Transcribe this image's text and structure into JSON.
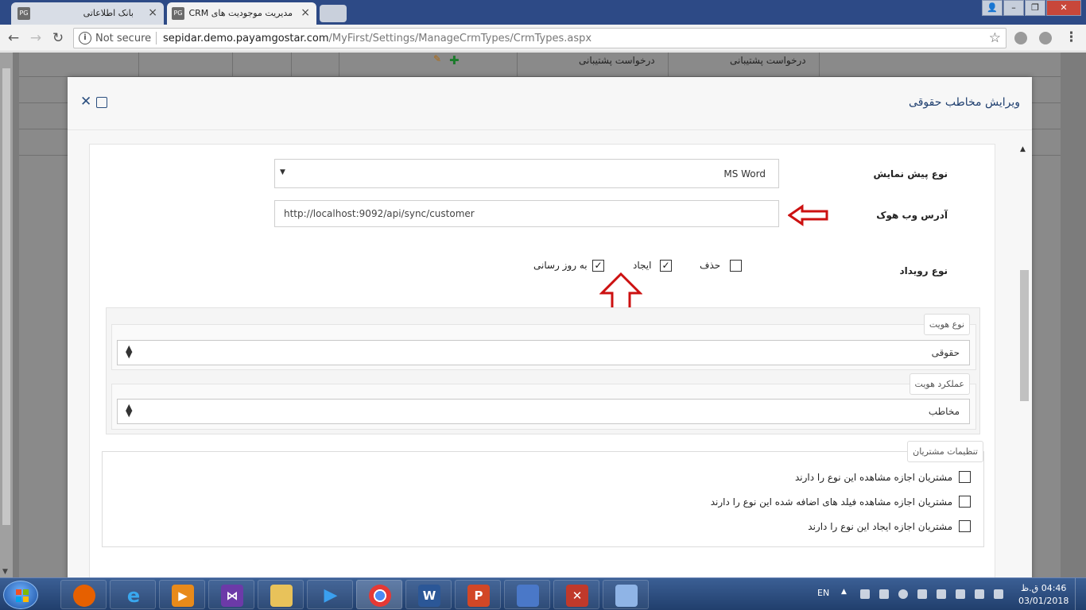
{
  "browser": {
    "tabs": [
      {
        "title": "بانک اطلاعاتی",
        "favicon": "PG"
      },
      {
        "title": "مدیریت موجودیت های CRM",
        "favicon": "PG",
        "active": true
      }
    ],
    "address": {
      "security": "Not secure",
      "host": "sepidar.demo.payamgostar.com",
      "path": "/MyFirst/Settings/ManageCrmTypes/CrmTypes.aspx"
    }
  },
  "background": {
    "col_text_1": "درخواست پشتیبانی",
    "col_text_2": "درخواست پشتیبانی"
  },
  "modal": {
    "title": "ویرایش مخاطب حقوقی",
    "preview_type": {
      "label": "نوع پیش نمایش",
      "value": "MS Word"
    },
    "webhook": {
      "label": "آدرس وب هوک",
      "value": "http://localhost:9092/api/sync/customer"
    },
    "event_type": {
      "label": "نوع رویداد",
      "options": [
        {
          "label": "حذف",
          "checked": false
        },
        {
          "label": "ایجاد",
          "checked": true
        },
        {
          "label": "به روز رسانی",
          "checked": true
        }
      ]
    },
    "identity_type": {
      "legend": "نوع هویت",
      "value": "حقوقی"
    },
    "identity_function": {
      "legend": "عملکرد هویت",
      "value": "مخاطب"
    },
    "customer_settings": {
      "legend": "تنظیمات مشتریان",
      "items": [
        {
          "label": "مشتریان اجازه مشاهده این نوع را دارند",
          "checked": false
        },
        {
          "label": "مشتریان اجازه مشاهده فیلد های اضافه شده این نوع را دارند",
          "checked": false
        },
        {
          "label": "مشتریان اجازه ایجاد این نوع را دارند",
          "checked": false
        }
      ]
    }
  },
  "taskbar": {
    "lang": "EN",
    "time": "04:46 ق.ظ",
    "date": "03/01/2018"
  },
  "colors": {
    "modal_title": "#1f3f6f",
    "annotation_arrow": "#cc1111",
    "taskbar": "#2a4a7c"
  },
  "icons": {
    "check": "✓",
    "close": "✕",
    "caret": "▼",
    "updown": "◆"
  }
}
